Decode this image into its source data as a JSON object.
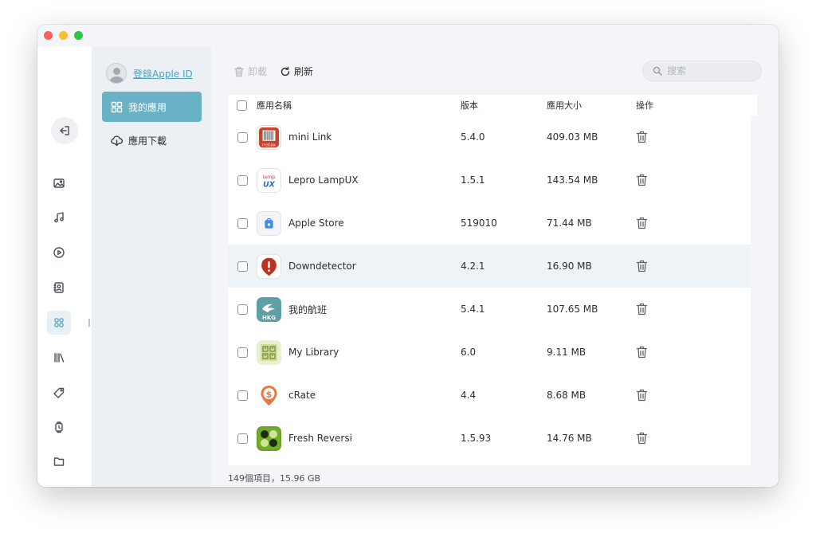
{
  "window": {
    "traffic_lights": [
      "close",
      "minimize",
      "zoom"
    ]
  },
  "rail": {
    "items": [
      {
        "icon": "back-icon"
      },
      {
        "icon": "photo-icon"
      },
      {
        "icon": "music-icon"
      },
      {
        "icon": "video-icon"
      },
      {
        "icon": "contacts-icon"
      },
      {
        "icon": "apps-icon",
        "active": true
      },
      {
        "icon": "books-icon"
      },
      {
        "icon": "tag-icon"
      },
      {
        "icon": "watch-icon"
      },
      {
        "icon": "folder-icon"
      }
    ]
  },
  "sidebar": {
    "account_link": "登錄Apple ID",
    "nav": [
      {
        "label": "我的應用",
        "icon": "apps-grid-icon",
        "active": true
      },
      {
        "label": "應用下載",
        "icon": "cloud-download-icon",
        "active": false
      }
    ]
  },
  "toolbar": {
    "uninstall_label": "卸載",
    "refresh_label": "刷新",
    "search_placeholder": "搜索"
  },
  "table": {
    "columns": [
      "應用名稱",
      "版本",
      "應用大小",
      "操作"
    ],
    "rows": [
      {
        "name": "mini Link",
        "version": "5.4.0",
        "size": "409.03 MB",
        "icon": "instax-icon",
        "icon_text": "instax"
      },
      {
        "name": "Lepro LampUX",
        "version": "1.5.1",
        "size": "143.54 MB",
        "icon": "lampux-icon",
        "icon_text": "lamp UX"
      },
      {
        "name": "Apple Store",
        "version": "519010",
        "size": "71.44 MB",
        "icon": "apple-store-icon"
      },
      {
        "name": "Downdetector",
        "version": "4.2.1",
        "size": "16.90 MB",
        "icon": "downdetector-icon",
        "highlight": true
      },
      {
        "name": "我的航班",
        "version": "5.4.1",
        "size": "107.65 MB",
        "icon": "hkg-flight-icon",
        "icon_text": "HKG"
      },
      {
        "name": "My Library",
        "version": "6.0",
        "size": "9.11 MB",
        "icon": "library-icon"
      },
      {
        "name": "cRate",
        "version": "4.4",
        "size": "8.68 MB",
        "icon": "crate-icon"
      },
      {
        "name": "Fresh Reversi",
        "version": "1.5.93",
        "size": "14.76 MB",
        "icon": "reversi-icon"
      }
    ]
  },
  "footer": {
    "summary": "149個項目，15.96 GB"
  },
  "colors": {
    "accent": "#69b2c6",
    "link": "#4ea3be",
    "row_highlight": "#eef3f8"
  }
}
